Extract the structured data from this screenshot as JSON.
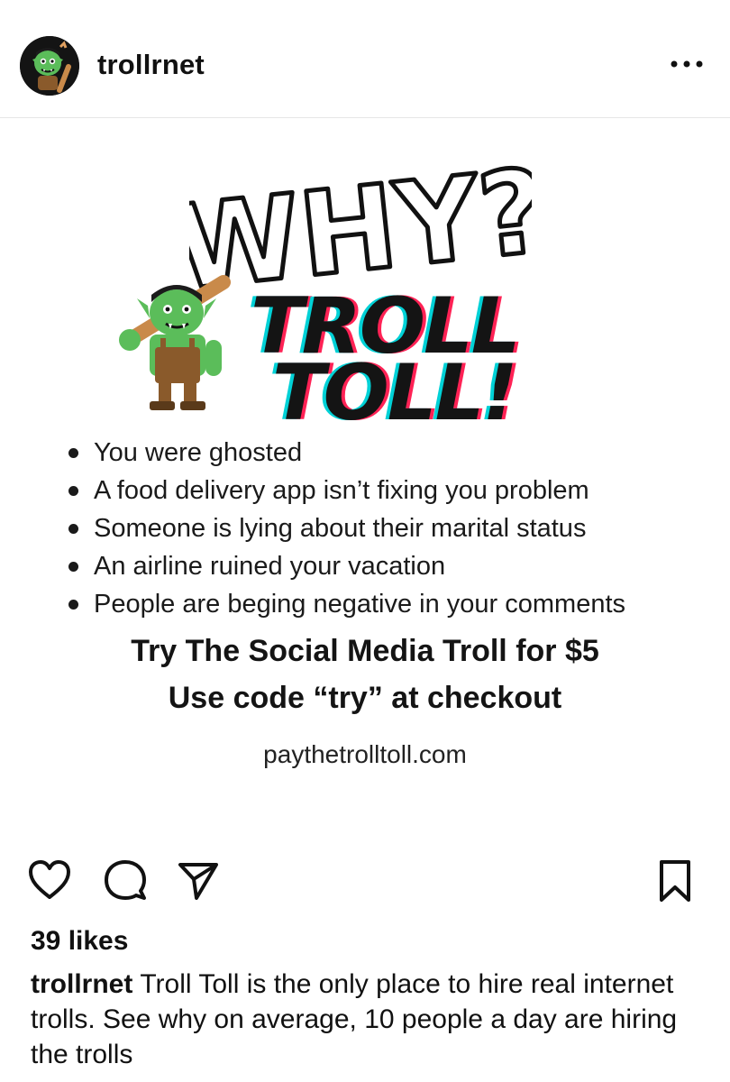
{
  "post": {
    "username": "trollrnet",
    "more_icon": "more-horizontal-icon",
    "avatar_icon": "troll-avatar-icon"
  },
  "image": {
    "headline": "WHY?",
    "brand_line1": "TROLL",
    "brand_line2": "TOLL!",
    "bullets": [
      "You were ghosted",
      "A food delivery app isn’t fixing you problem",
      "Someone is lying about their marital status",
      "An airline ruined your vacation",
      "People are beging negative in your comments"
    ],
    "promo_line1": "Try The Social Media Troll for $5",
    "promo_line2": "Use code “try” at checkout",
    "website": "paythetrolltoll.com"
  },
  "actions": {
    "like_icon": "heart-icon",
    "comment_icon": "comment-icon",
    "share_icon": "send-icon",
    "save_icon": "bookmark-icon"
  },
  "likes_text": "39 likes",
  "caption": {
    "user": "trollrnet",
    "text": "Troll Toll is the only place to hire real internet trolls. See why on average, 10 people a day are hiring the trolls"
  },
  "colors": {
    "troll_green": "#5bbd5a",
    "troll_brown": "#8a5a2b",
    "accent_cyan": "#00d1d6",
    "accent_pink": "#ff2255"
  }
}
